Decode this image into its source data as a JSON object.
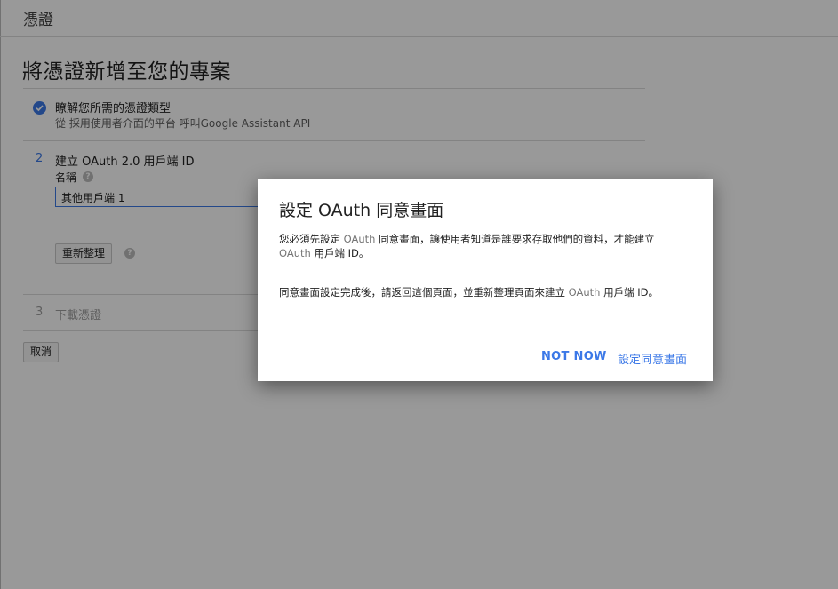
{
  "topbar": {
    "title": "憑證"
  },
  "page": {
    "title": "將憑證新增至您的專案"
  },
  "step1": {
    "title": "瞭解您所需的憑證類型",
    "subtitle": "從 採用使用者介面的平台 呼叫Google Assistant API"
  },
  "step2": {
    "number": "2",
    "title": "建立 OAuth 2.0 用戶端 ID",
    "name_label": "名稱",
    "name_value": "其他用戶端 1",
    "refresh_label": "重新整理"
  },
  "step3": {
    "number": "3",
    "title": "下載憑證"
  },
  "cancel_label": "取消",
  "dialog": {
    "title": "設定 OAuth 同意畫面",
    "p1_a": "您必須先設定 ",
    "p1_link1": "OAuth",
    "p1_b": " 同意畫面，讓使用者知道是誰要求存取他們的資料，才能建立 ",
    "p1_link2": "OAuth",
    "p1_c": " 用戶端 ID。",
    "p2_a": "同意畫面設定完成後，請返回這個頁面，並重新整理頁面來建立 ",
    "p2_link": "OAuth",
    "p2_b": " 用戶端 ID。",
    "not_now": "NOT NOW",
    "configure": "設定同意畫面"
  },
  "icons": {
    "step1": "check-circle-icon",
    "help": "help-icon"
  },
  "colors": {
    "accent": "#3b78e7",
    "scrim": "rgba(0,0,0,0.40)"
  }
}
